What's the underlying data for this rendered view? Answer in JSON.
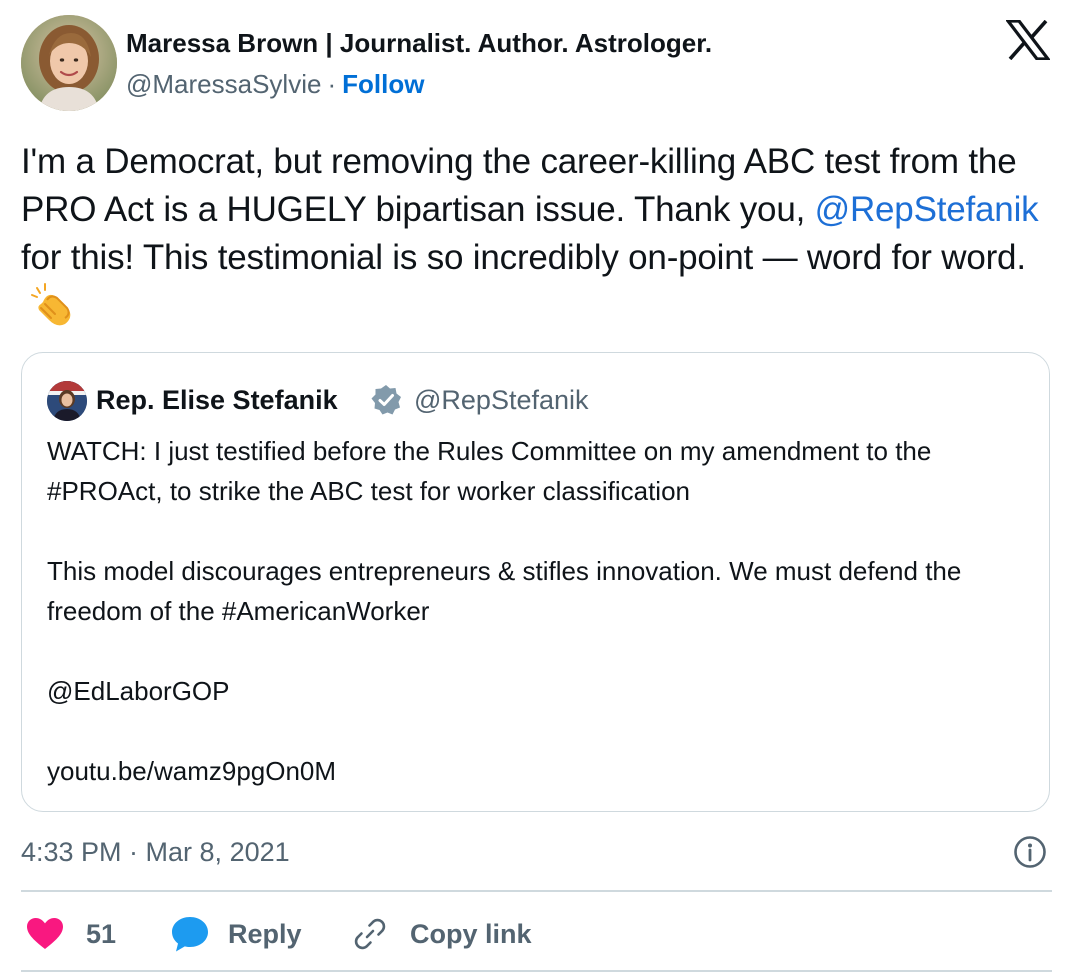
{
  "author": {
    "name": "Maressa Brown | Journalist. Author. Astrologer.",
    "handle": "@MaressaSylvie",
    "separator": "·",
    "follow_label": "Follow"
  },
  "logo": "x-logo",
  "tweet": {
    "text_before": "I'm a Democrat, but removing the career-killing ABC test from the PRO Act is a HUGELY bipartisan issue. Thank you, ",
    "mention": "@RepStefanik",
    "text_after": " for this! This testimonial is so incredibly on-point — word for word.",
    "emoji": "clapping-hands-icon"
  },
  "quoted_tweet": {
    "name": "Rep. Elise Stefanik",
    "verified_icon": "verified-badge-icon",
    "handle": "@RepStefanik",
    "paragraphs": [
      "WATCH: I just testified before the Rules Committee on my amendment to the #PROAct, to strike the ABC test for worker classification",
      "This model discourages entrepreneurs & stifles innovation. We must defend the freedom of the #AmericanWorker",
      "@EdLaborGOP",
      "youtu.be/wamz9pgOn0M"
    ]
  },
  "meta": {
    "timestamp": "4:33 PM · Mar 8, 2021",
    "info_icon": "info-icon"
  },
  "actions": {
    "like_count": "51",
    "reply_label": "Reply",
    "copy_link_label": "Copy link"
  },
  "colors": {
    "link_blue": "#1d6fd6",
    "like_red": "#f91880",
    "reply_blue": "#1d9bf0",
    "muted_text": "#536471",
    "border": "#cfd9de"
  }
}
